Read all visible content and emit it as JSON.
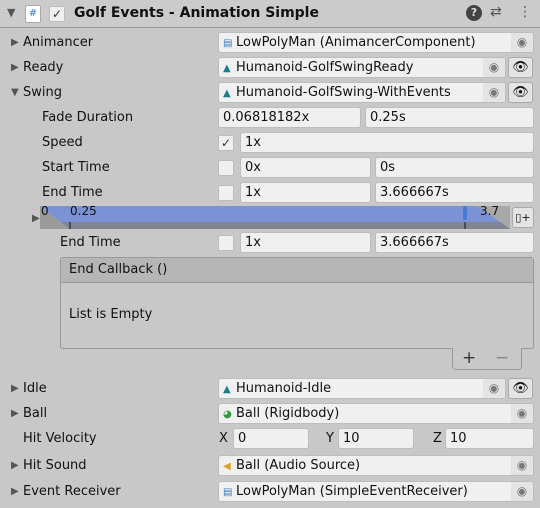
{
  "header": {
    "title": "Golf Events - Animation Simple",
    "enabled": true
  },
  "fields": {
    "animancer": {
      "label": "Animancer",
      "value": "LowPolyMan (AnimancerComponent)"
    },
    "ready": {
      "label": "Ready",
      "value": "Humanoid-GolfSwingReady"
    },
    "swing": {
      "label": "Swing",
      "value": "Humanoid-GolfSwing-WithEvents",
      "fade": {
        "label": "Fade Duration",
        "a": "0.06818182x",
        "b": "0.25s"
      },
      "speed": {
        "label": "Speed",
        "checked": true,
        "a": "1x"
      },
      "start": {
        "label": "Start Time",
        "checked": false,
        "a": "0x",
        "b": "0s"
      },
      "end": {
        "label": "End Time",
        "checked": false,
        "a": "1x",
        "b": "3.666667s"
      },
      "timeline": {
        "start": "0",
        "fade": "0.25",
        "end": "3.7"
      },
      "end_event": {
        "label": "End Time",
        "checked": false,
        "a": "1x",
        "b": "3.666667s"
      },
      "callback": {
        "title": "End Callback ()",
        "empty": "List is Empty",
        "add": "+",
        "remove": "−"
      }
    },
    "idle": {
      "label": "Idle",
      "value": "Humanoid-Idle"
    },
    "ball": {
      "label": "Ball",
      "value": "Ball (Rigidbody)"
    },
    "hit_velocity": {
      "label": "Hit Velocity",
      "x_label": "X",
      "x": "0",
      "y_label": "Y",
      "y": "10",
      "z_label": "Z",
      "z": "10"
    },
    "hit_sound": {
      "label": "Hit Sound",
      "value": "Ball (Audio Source)"
    },
    "event_receiver": {
      "label": "Event Receiver",
      "value": "LowPolyMan (SimpleEventReceiver)"
    }
  },
  "colors": {
    "timeline": "#7b93d4",
    "anim": "#1a7f8a",
    "rigidbody": "#2a9a3a",
    "audio": "#e0a020"
  }
}
